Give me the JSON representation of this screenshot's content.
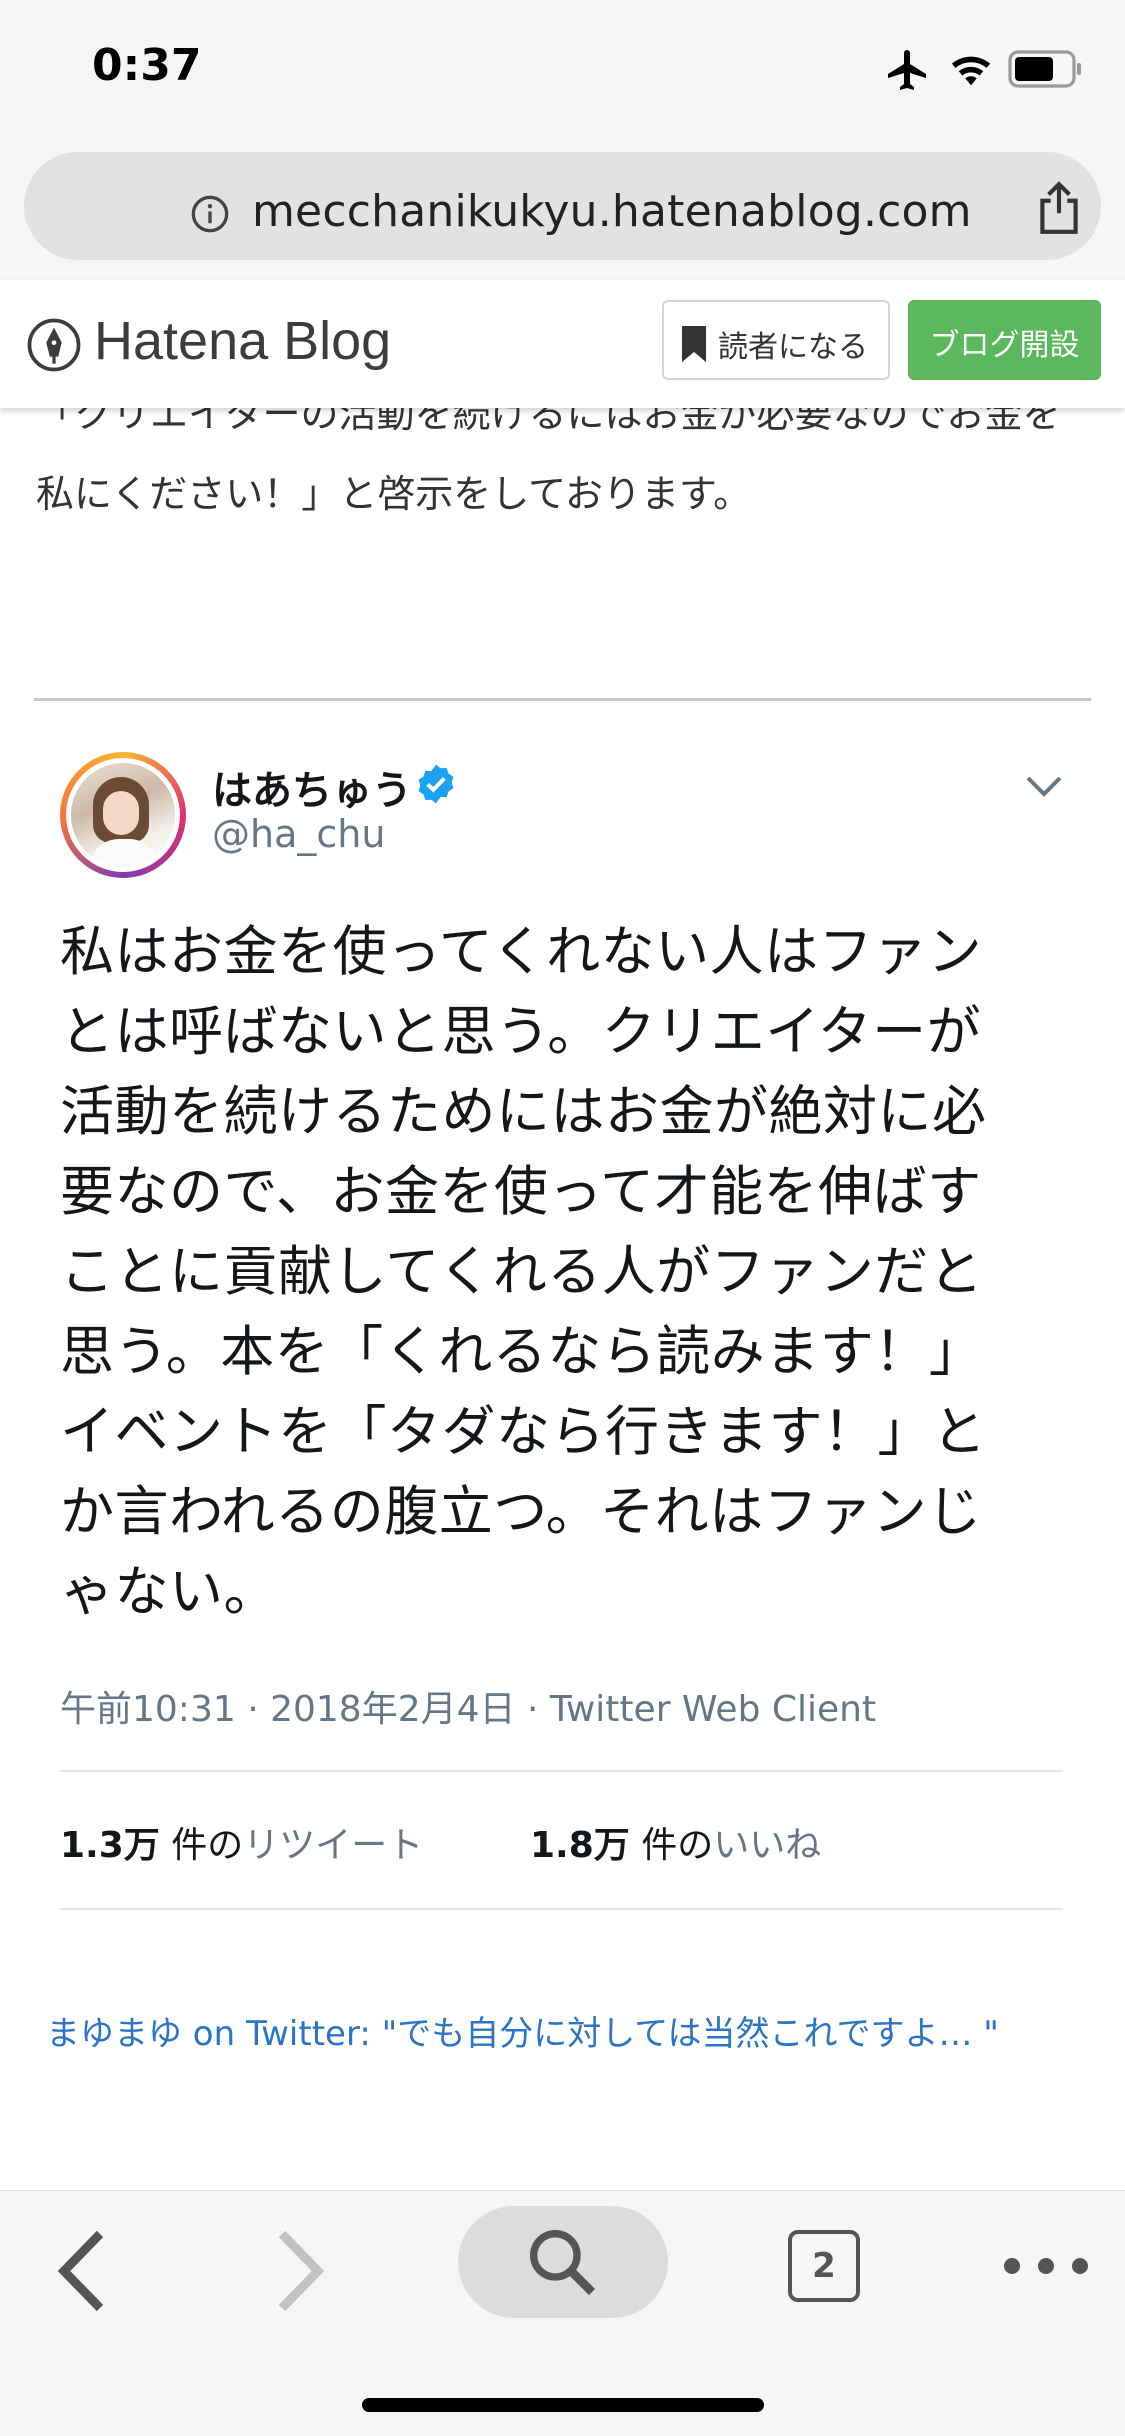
{
  "status_bar": {
    "time": "0:37"
  },
  "browser": {
    "url": "mecchanikukyu.hatenablog.com",
    "tab_count": "2"
  },
  "hatena_header": {
    "logo_text": "Hatena Blog",
    "reader_button_label": "読者になる",
    "blog_open_button_label": "ブログ開設"
  },
  "article": {
    "text": "「クリエイターの活動を続けるにはお金が必要なのでお金を私にください！」と啓示をしております。"
  },
  "tweet": {
    "display_name": "はあちゅう",
    "handle": "@ha_chu",
    "body": "私はお金を使ってくれない人はファン\nとは呼ばないと思う。クリエイターが\n活動を続けるためにはお金が絶対に必\n要なので、お金を使って才能を伸ばす\nことに貢献してくれる人がファンだと\n思う。本を「くれるなら読みます！」\nイベントを「タダなら行きます！」と\nか言われるの腹立つ。それはファンじ\nゃない。",
    "meta": "午前10:31 · 2018年2月4日 · Twitter Web Client",
    "retweets": {
      "count": "1.3万",
      "of": " 件の",
      "label": "リツイート"
    },
    "likes": {
      "count": "1.8万",
      "of": " 件の",
      "label": "いいね"
    }
  },
  "embed_link": {
    "text": "まゆまゆ on Twitter: \"でも自分に対しては当然これですよ… \""
  },
  "colors": {
    "hatena_green": "#5cb85c",
    "twitter_blue": "#1da1f2",
    "link_blue": "#2a74c9",
    "meta_gray": "#657786"
  },
  "icons": [
    "airplane-icon",
    "wifi-icon",
    "battery-icon",
    "info-icon",
    "share-icon",
    "hatena-pen-icon",
    "bookmark-icon",
    "verified-icon",
    "caret-down-icon",
    "back-icon",
    "forward-icon",
    "search-icon",
    "more-icon"
  ]
}
